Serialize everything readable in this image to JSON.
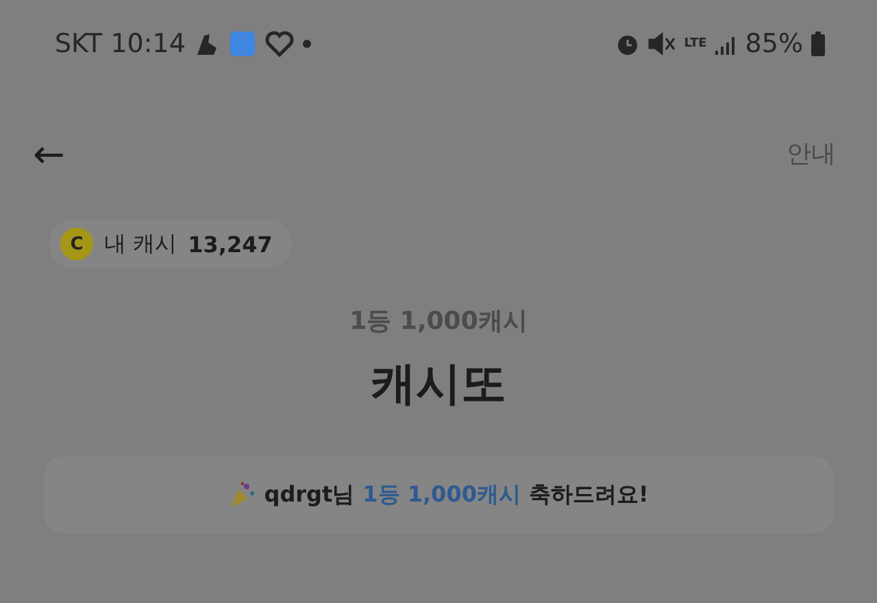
{
  "status_bar": {
    "carrier_time": "SKT 10:14",
    "network": "LTE",
    "battery": "85%"
  },
  "header": {
    "back": "←",
    "info": "안내"
  },
  "cash_chip": {
    "coin": "C",
    "label": "내 캐시",
    "amount": "13,247"
  },
  "prize": "1등 1,000캐시",
  "title": "캐시또",
  "banner": {
    "parts": [
      {
        "text": "qdrgt님",
        "highlight": false
      },
      {
        "text": "1등 1,000캐시",
        "highlight": true
      },
      {
        "text": "축하드려요!",
        "highlight": false
      }
    ]
  }
}
